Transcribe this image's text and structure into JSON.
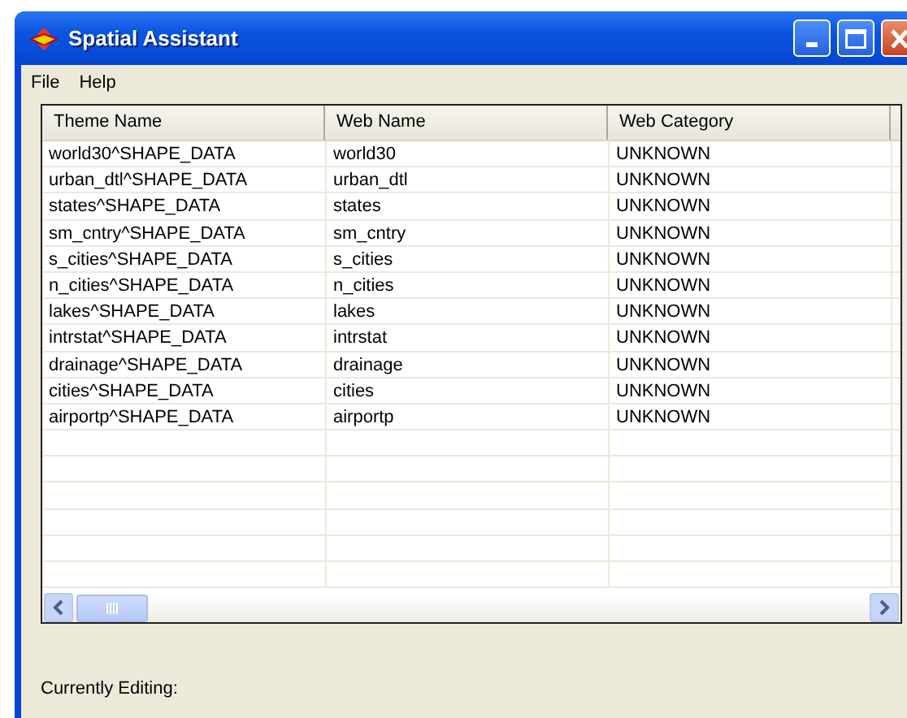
{
  "window": {
    "title": "Spatial Assistant"
  },
  "menu": [
    "File",
    "Help"
  ],
  "table": {
    "columns": [
      "Theme Name",
      "Web Name",
      "Web Category"
    ],
    "rows": [
      [
        "world30^SHAPE_DATA",
        "world30",
        "UNKNOWN"
      ],
      [
        "urban_dtl^SHAPE_DATA",
        "urban_dtl",
        "UNKNOWN"
      ],
      [
        "states^SHAPE_DATA",
        "states",
        "UNKNOWN"
      ],
      [
        "sm_cntry^SHAPE_DATA",
        "sm_cntry",
        "UNKNOWN"
      ],
      [
        "s_cities^SHAPE_DATA",
        "s_cities",
        "UNKNOWN"
      ],
      [
        "n_cities^SHAPE_DATA",
        "n_cities",
        "UNKNOWN"
      ],
      [
        "lakes^SHAPE_DATA",
        "lakes",
        "UNKNOWN"
      ],
      [
        "intrstat^SHAPE_DATA",
        "intrstat",
        "UNKNOWN"
      ],
      [
        "drainage^SHAPE_DATA",
        "drainage",
        "UNKNOWN"
      ],
      [
        "cities^SHAPE_DATA",
        "cities",
        "UNKNOWN"
      ],
      [
        "airportp^SHAPE_DATA",
        "airportp",
        "UNKNOWN"
      ]
    ]
  },
  "status": {
    "label": "Currently Editing:"
  }
}
